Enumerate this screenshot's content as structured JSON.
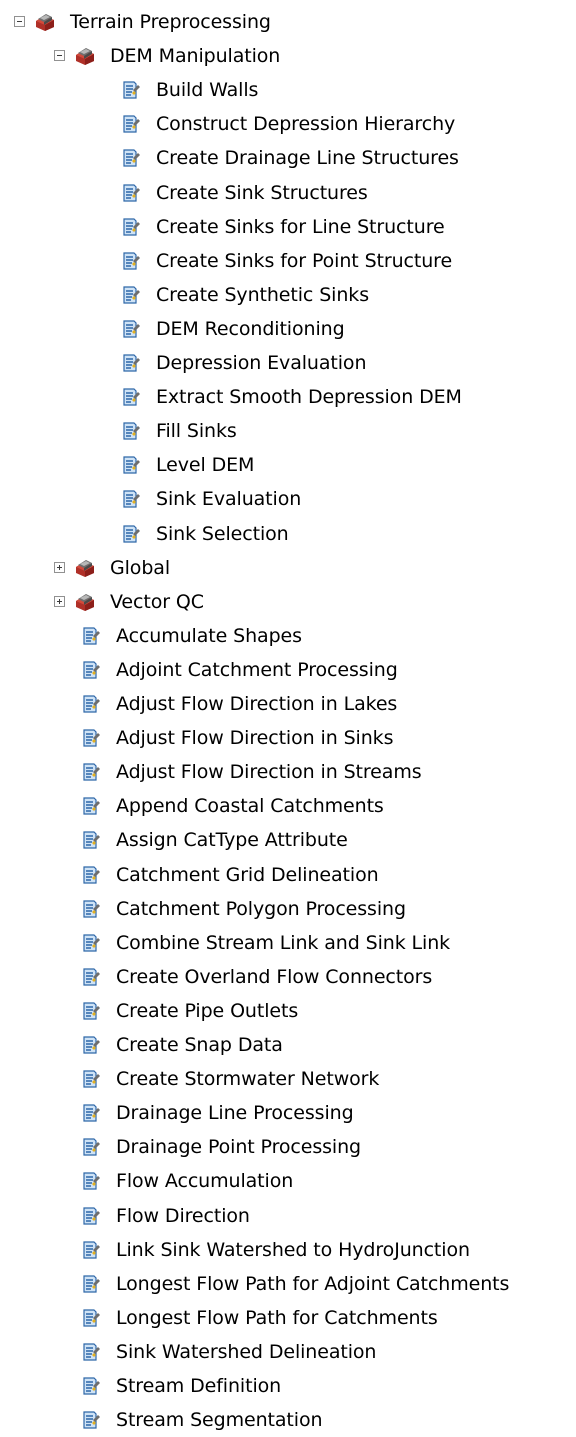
{
  "tree": {
    "root": {
      "label": "Terrain Preprocessing",
      "state": "expanded",
      "icon": "toolbox-icon",
      "children": [
        {
          "label": "DEM Manipulation",
          "state": "expanded",
          "icon": "toolbox-icon",
          "tools": [
            "Build Walls",
            "Construct Depression Hierarchy",
            "Create Drainage Line Structures",
            "Create Sink Structures",
            "Create Sinks for Line Structure",
            "Create Sinks for Point Structure",
            "Create Synthetic Sinks",
            "DEM Reconditioning",
            "Depression Evaluation",
            "Extract Smooth Depression DEM",
            "Fill Sinks",
            "Level DEM",
            "Sink Evaluation",
            "Sink Selection"
          ]
        },
        {
          "label": "Global",
          "state": "collapsed",
          "icon": "toolbox-icon",
          "tools": []
        },
        {
          "label": "Vector QC",
          "state": "collapsed",
          "icon": "toolbox-icon",
          "tools": []
        }
      ],
      "tools": [
        "Accumulate Shapes",
        "Adjoint Catchment Processing",
        "Adjust Flow Direction in Lakes",
        "Adjust Flow Direction in Sinks",
        "Adjust Flow Direction in Streams",
        "Append Coastal Catchments",
        "Assign CatType Attribute",
        "Catchment Grid Delineation",
        "Catchment Polygon Processing",
        "Combine Stream Link and Sink Link",
        "Create Overland Flow Connectors",
        "Create Pipe Outlets",
        "Create Snap Data",
        "Create Stormwater Network",
        "Drainage Line Processing",
        "Drainage Point Processing",
        "Flow Accumulation",
        "Flow Direction",
        "Link Sink Watershed to HydroJunction",
        "Longest Flow Path for Adjoint Catchments",
        "Longest Flow Path for Catchments",
        "Sink Watershed Delineation",
        "Stream Definition",
        "Stream Segmentation"
      ]
    }
  }
}
